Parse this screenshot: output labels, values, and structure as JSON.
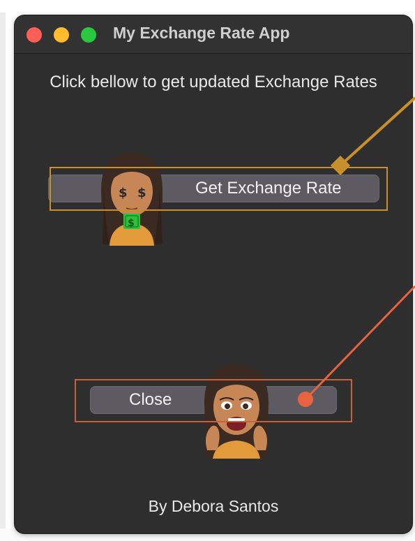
{
  "window": {
    "title": "My Exchange Rate App",
    "traffic_lights": {
      "close_color": "#fe5f57",
      "minimize_color": "#febc2e",
      "maximize_color": "#28c840"
    }
  },
  "main": {
    "instruction": "Click bellow to get updated Exchange Rates",
    "get_rate_button_label": "Get Exchange Rate",
    "close_button_label": "Close",
    "footer_text": "By Debora Santos"
  },
  "annotations": {
    "get_rate_color": "#c7902a",
    "close_color": "#e8633e"
  },
  "icons": {
    "avatar_money": "avatar-money-eyes-icon",
    "avatar_waving": "avatar-excited-icon"
  }
}
